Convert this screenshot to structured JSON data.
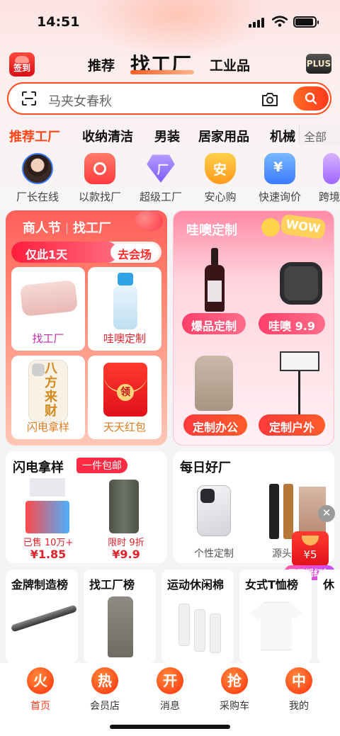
{
  "status": {
    "time": "14:51"
  },
  "header": {
    "signin_label": "签到",
    "tabs": [
      "推荐",
      "找工厂",
      "工业品"
    ],
    "plus_label": "PLUS"
  },
  "search": {
    "placeholder": "马夹女春秋"
  },
  "categories": [
    "推荐工厂",
    "收纳清洁",
    "男装",
    "居家用品",
    "机械",
    "全部"
  ],
  "quick": [
    "厂长在线",
    "以款找厂",
    "超级工厂",
    "安心购",
    "快速询价",
    "跨境"
  ],
  "card_left": {
    "title_a": "商人节",
    "title_b": "找工厂",
    "banner": "仅此1天",
    "cta": "去会场",
    "tiles": [
      "找工厂",
      "哇噢定制",
      "闪电拿样",
      "天天红包"
    ],
    "phone_text": "八方来财",
    "packet_char": "领"
  },
  "card_right": {
    "title": "哇噢定制",
    "wow_text": "WOW",
    "pills": [
      "爆品定制",
      "哇噢 9.9",
      "定制办公",
      "定制户外"
    ]
  },
  "flash": {
    "title": "闪电拿样",
    "badge": "一件包邮",
    "items": [
      {
        "note": "已售 10万+",
        "price": "¥1.85"
      },
      {
        "note": "限时 9折",
        "price": "¥9.9"
      }
    ]
  },
  "daily": {
    "title": "每日好厂",
    "labels": [
      "个性定制",
      "源头"
    ]
  },
  "ranks": [
    "金牌制造榜",
    "找工厂榜",
    "运动休闲棉",
    "女式T恤榜",
    "休"
  ],
  "packet": {
    "amount": "¥5",
    "tag": "天天摇红包",
    "close": "✕"
  },
  "nav": [
    {
      "icon_char": "火",
      "label": "首页"
    },
    {
      "icon_char": "热",
      "label": "会员店"
    },
    {
      "icon_char": "开",
      "label": "消息"
    },
    {
      "icon_char": "抢",
      "label": "采购车"
    },
    {
      "icon_char": "中",
      "label": "我的"
    }
  ],
  "colors": {
    "accent": "#ff4416",
    "brand_red": "#e0222a",
    "pink": "#ff3f6a"
  }
}
